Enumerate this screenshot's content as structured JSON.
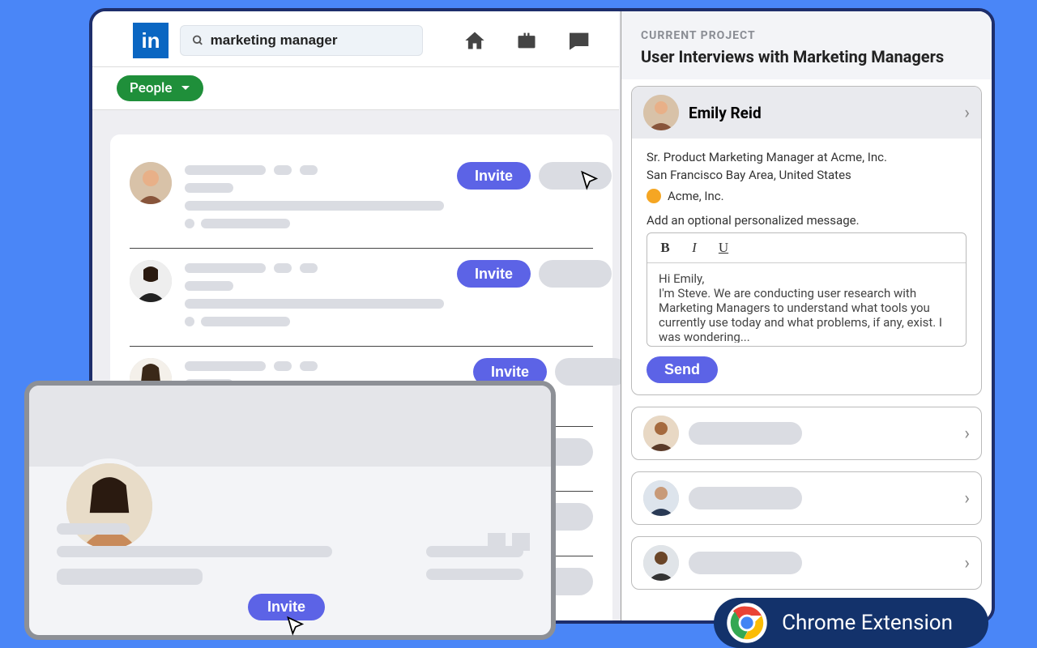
{
  "header": {
    "logo_text": "in",
    "search_value": "marketing manager"
  },
  "filter": {
    "people_label": "People"
  },
  "results": {
    "invite_label": "Invite"
  },
  "panel": {
    "eyebrow": "CURRENT PROJECT",
    "title": "User Interviews with Marketing Managers",
    "contact": {
      "name": "Emily Reid",
      "role": "Sr. Product Marketing Manager at Acme, Inc.",
      "location": "San Francisco Bay Area, United States",
      "company": "Acme, Inc."
    },
    "message": {
      "label": "Add an optional personalized message.",
      "body": "Hi Emily,\nI'm Steve. We are conducting user research with Marketing Managers to understand what tools you currently use today and what problems, if any, exist. I was wondering...",
      "send_label": "Send"
    }
  },
  "float": {
    "invite_label": "Invite"
  },
  "badge": {
    "label": "Chrome Extension"
  }
}
